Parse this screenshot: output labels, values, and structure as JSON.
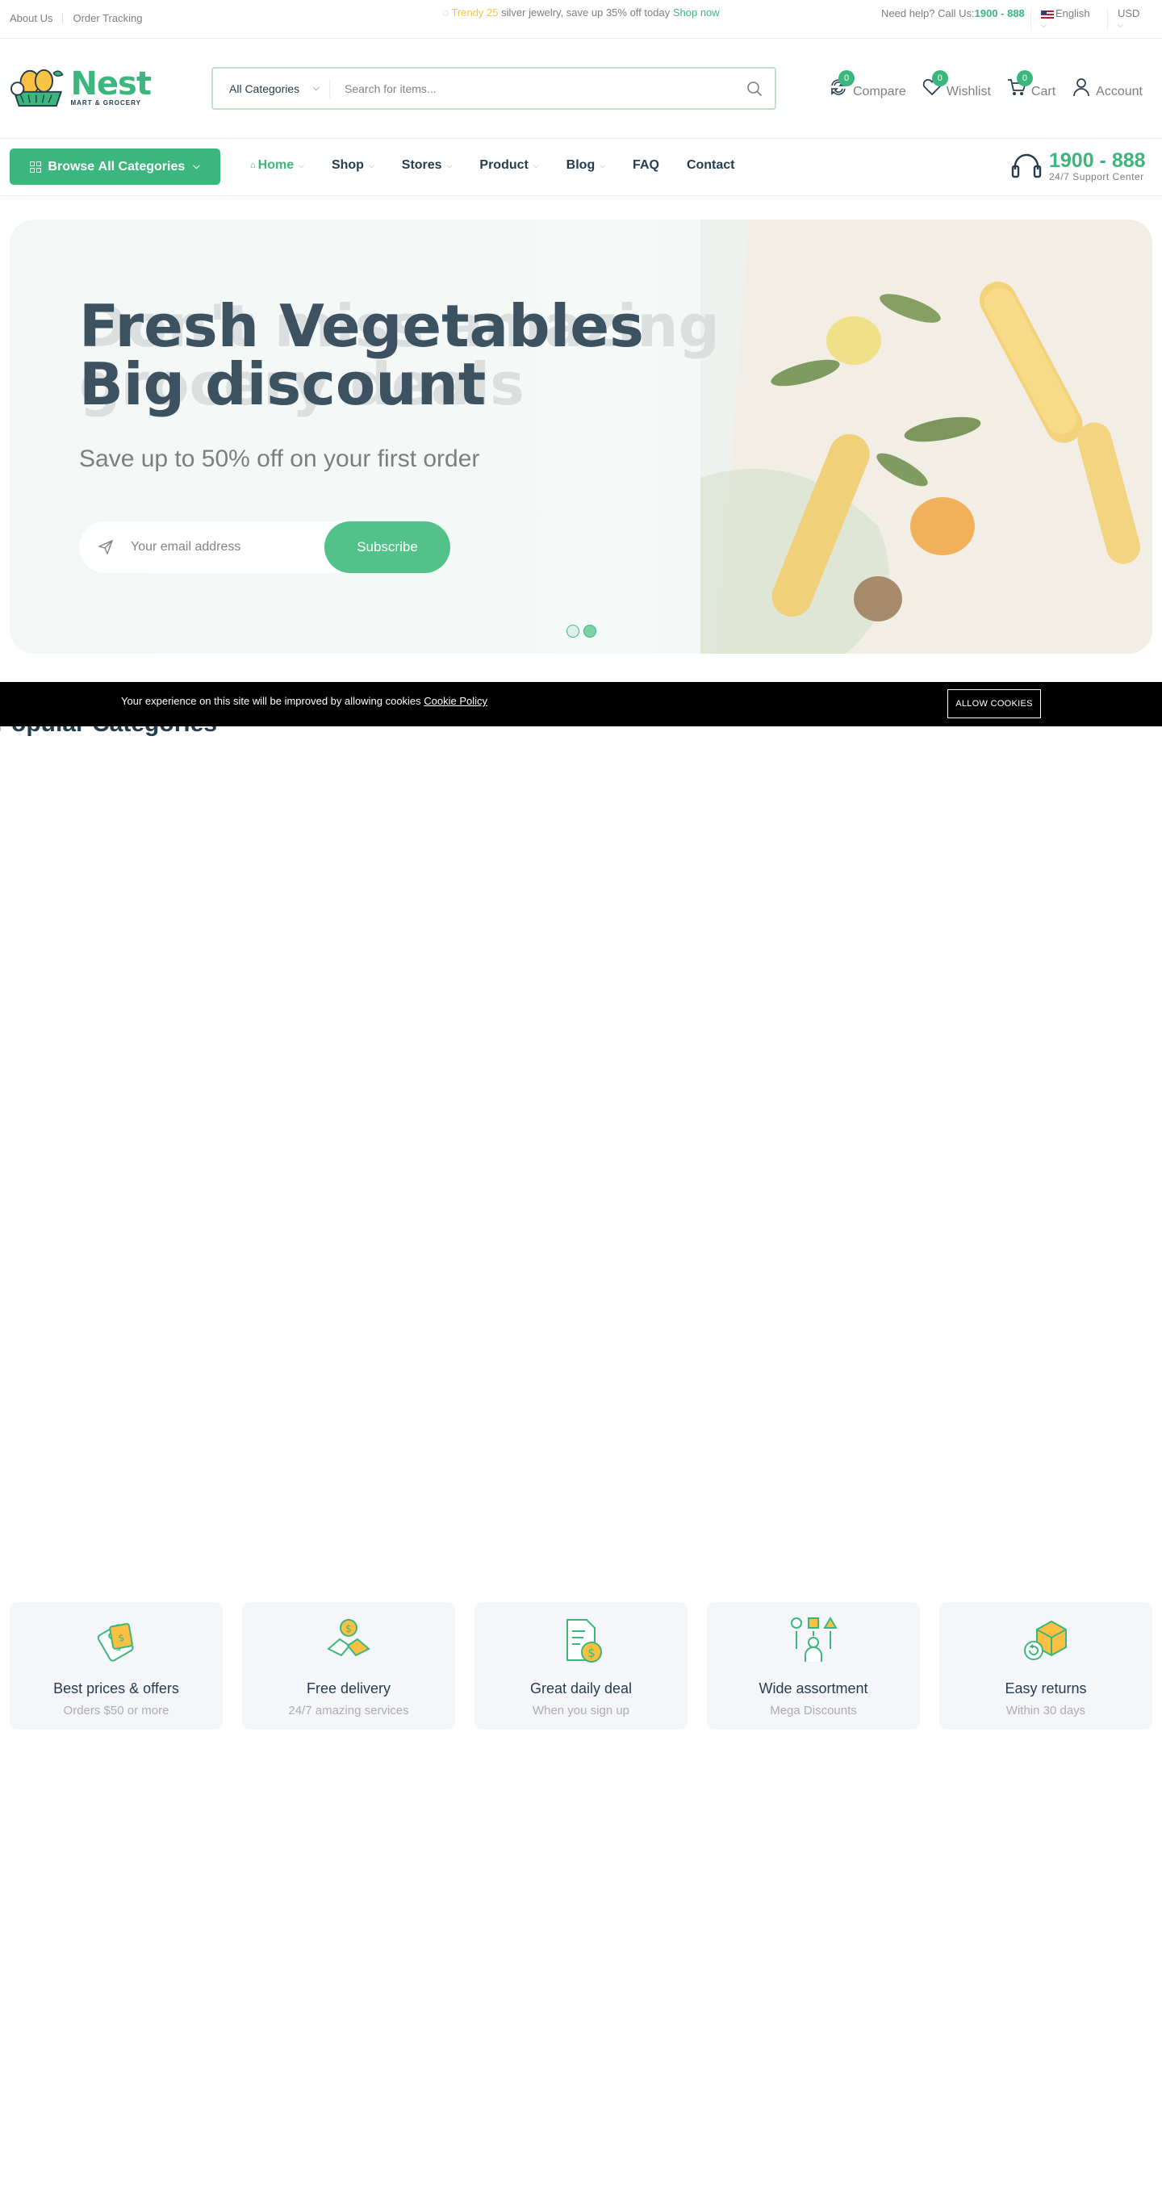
{
  "topbar": {
    "links": [
      "About Us",
      "Order Tracking"
    ],
    "promo_prefix": "Trendy 25",
    "promo_text": "silver jewelry, save up 35% off today",
    "promo_link": "Shop now",
    "help_label": "Need help? Call Us:",
    "help_phone": "1900 - 888",
    "language": "English",
    "currency": "USD"
  },
  "header": {
    "logo_title": "Nest",
    "logo_subtitle": "MART & GROCERY",
    "search": {
      "category": "All Categories",
      "placeholder": "Search for items..."
    },
    "actions": [
      {
        "label": "Compare",
        "count": "0",
        "icon": "compare-icon"
      },
      {
        "label": "Wishlist",
        "count": "0",
        "icon": "heart-icon"
      },
      {
        "label": "Cart",
        "count": "0",
        "icon": "cart-icon"
      },
      {
        "label": "Account",
        "icon": "user-icon"
      }
    ]
  },
  "nav": {
    "browse_prefix": "Browse",
    "browse_label": "All Categories",
    "items": [
      "Home",
      "Shop",
      "Stores",
      "Product",
      "Blog",
      "FAQ",
      "Contact"
    ],
    "support_number": "1900 - 888",
    "support_label": "24/7 Support Center"
  },
  "hero": {
    "title_line1": "Fresh Vegetables",
    "title_line2": "Big discount",
    "ghost_line1": "Don't miss amazing",
    "ghost_line2": "grocery deals",
    "subtitle": "Save up to 50% off on your first order",
    "email_placeholder": "Your email address",
    "subscribe_label": "Subscribe"
  },
  "cookie": {
    "text": "Your experience on this site will be improved by allowing cookies",
    "policy_link": "Cookie Policy",
    "button": "ALLOW COOKIES"
  },
  "behind_heading": "Popular Categories",
  "features": [
    {
      "title": "Best prices & offers",
      "subtitle": "Orders $50 or more",
      "icon": "price-tag-icon"
    },
    {
      "title": "Free delivery",
      "subtitle": "24/7 amazing services",
      "icon": "delivery-handshake-icon"
    },
    {
      "title": "Great daily deal",
      "subtitle": "When you sign up",
      "icon": "daily-deal-icon"
    },
    {
      "title": "Wide assortment",
      "subtitle": "Mega Discounts",
      "icon": "assortment-icon"
    },
    {
      "title": "Easy returns",
      "subtitle": "Within 30 days",
      "icon": "returns-box-icon"
    }
  ],
  "colors": {
    "brand": "#3bb77e",
    "heading": "#253d4e",
    "muted": "#7e7e7e",
    "feature_bg": "#f4f6fa",
    "cookie_bg": "#000000"
  }
}
